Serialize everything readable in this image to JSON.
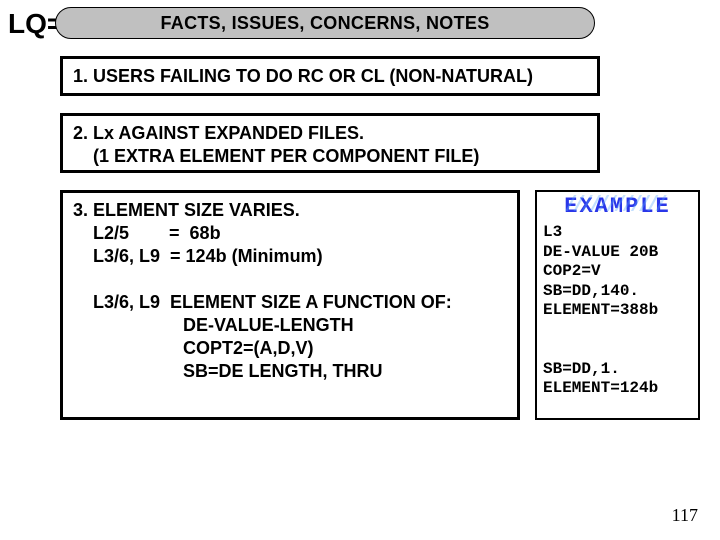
{
  "lq_label": "LQ=",
  "header": "FACTS, ISSUES, CONCERNS, NOTES",
  "boxes": {
    "b1": "1. USERS FAILING TO DO  RC OR CL (NON-NATURAL)",
    "b2": "2. Lx AGAINST EXPANDED FILES.\n    (1 EXTRA ELEMENT PER COMPONENT FILE)",
    "b3": "3. ELEMENT SIZE VARIES.\n    L2/5        =  68b\n    L3/6, L9  = 124b (Minimum)\n\n    L3/6, L9  ELEMENT SIZE A FUNCTION OF:\n                      DE-VALUE-LENGTH\n                      COPT2=(A,D,V)\n                      SB=DE LENGTH, THRU"
  },
  "example": {
    "title": "EXAMPLE",
    "body": "L3\nDE-VALUE 20B\nCOP2=V\nSB=DD,140.\nELEMENT=388b\n\n\nSB=DD,1.\nELEMENT=124b"
  },
  "page_number": "117"
}
